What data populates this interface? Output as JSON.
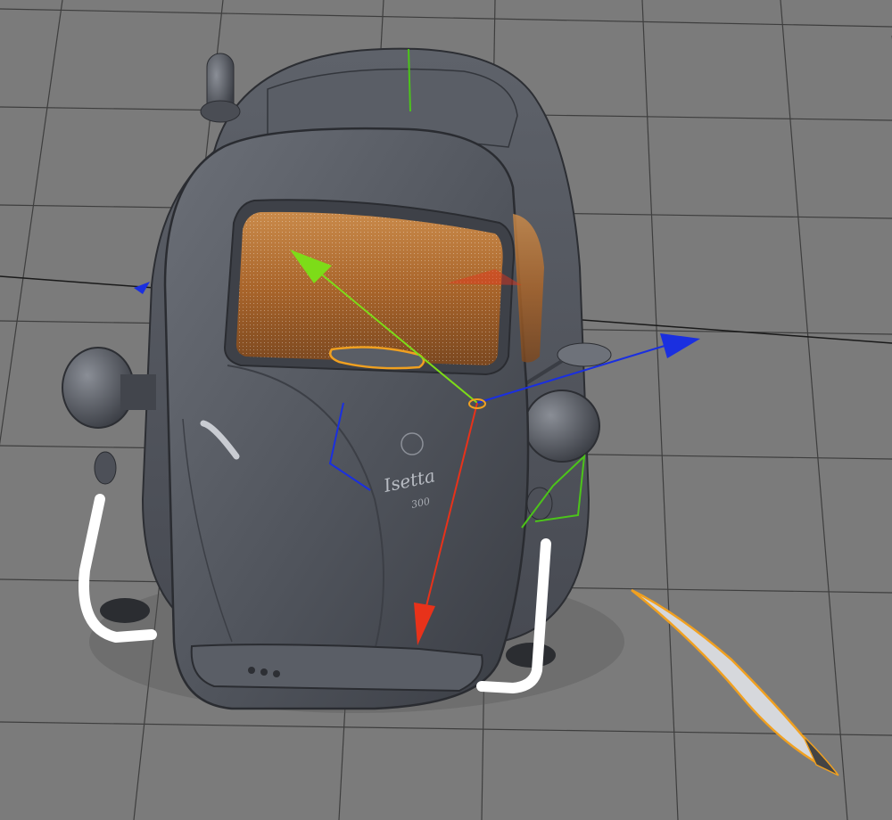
{
  "viewport": {
    "view_type": "3D perspective editor viewport",
    "background_color": "#7b7b7b",
    "grid_color": "#2a2a2a",
    "grid_visible": true
  },
  "model": {
    "kind": "microcar 3D model (top-front view)",
    "body_color": "#52565e",
    "interior_color": "#b06a2c",
    "bumper_color": "#ffffff",
    "badge_line1": "Isetta",
    "badge_line2": "300"
  },
  "gizmo": {
    "x_axis_color": "#1a2fe0",
    "y_axis_color": "#7ddc18",
    "z_axis_color": "#e8321a",
    "selection_color": "#f0a020"
  },
  "selected_object": {
    "name_icon": "needle-spline-object",
    "highlight_color": "#f0a020"
  },
  "icons": [
    "move-gizmo-icon",
    "world-axis-icon"
  ]
}
